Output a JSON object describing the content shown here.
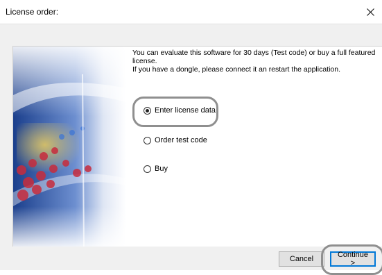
{
  "window": {
    "title": "License order:"
  },
  "intro": {
    "line1": "You can evaluate this software for 30 days (Test code) or buy a full featured",
    "line2": "license.",
    "line3": "If you have a dongle, please connect it an restart the application."
  },
  "options": [
    {
      "label": "Enter license data",
      "checked": true
    },
    {
      "label": "Order test code",
      "checked": false
    },
    {
      "label": "Buy",
      "checked": false
    }
  ],
  "buttons": {
    "cancel": "Cancel",
    "continue": "Continue >"
  },
  "colors": {
    "accent": "#0078d7",
    "highlight": "#8f8f8f"
  }
}
